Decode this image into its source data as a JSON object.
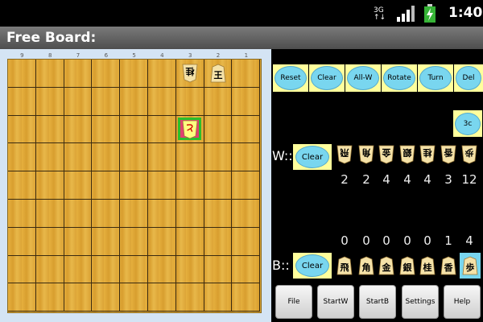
{
  "status": {
    "time": "1:40"
  },
  "title": "Free Board:",
  "board": {
    "file_labels": [
      "9",
      "8",
      "7",
      "6",
      "5",
      "4",
      "3",
      "2",
      "1"
    ],
    "pieces": [
      {
        "char": "桂",
        "file": 3,
        "rank": 1,
        "color": "#000",
        "rotated": true
      },
      {
        "char": "王",
        "file": 2,
        "rank": 1,
        "color": "#000",
        "rotated": false
      },
      {
        "char": "と",
        "file": 3,
        "rank": 3,
        "color": "#c00",
        "rotated": true
      }
    ]
  },
  "toolbar": [
    {
      "label": "Reset",
      "name": "reset-button"
    },
    {
      "label": "Clear",
      "name": "clear-button"
    },
    {
      "label": "All-W",
      "name": "all-w-button"
    },
    {
      "label": "Rotate",
      "name": "rotate-button"
    },
    {
      "label": "Turn",
      "name": "turn-button"
    },
    {
      "label": "Del",
      "name": "del-button"
    }
  ],
  "square_label": "3c",
  "white": {
    "label": "W::",
    "clear_label": "Clear",
    "pieces": [
      "飛",
      "角",
      "金",
      "銀",
      "桂",
      "香",
      "歩"
    ],
    "counts": [
      "2",
      "2",
      "4",
      "4",
      "4",
      "3",
      "12"
    ]
  },
  "black": {
    "label": "B::",
    "clear_label": "Clear",
    "pieces": [
      "飛",
      "角",
      "金",
      "銀",
      "桂",
      "香",
      "歩"
    ],
    "counts": [
      "0",
      "0",
      "0",
      "0",
      "0",
      "1",
      "4"
    ]
  },
  "bottom": [
    {
      "label": "File",
      "name": "file-button"
    },
    {
      "label": "StartW",
      "name": "start-w-button"
    },
    {
      "label": "StartB",
      "name": "start-b-button"
    },
    {
      "label": "Settings",
      "name": "settings-button"
    },
    {
      "label": "Help",
      "name": "help-button"
    }
  ]
}
